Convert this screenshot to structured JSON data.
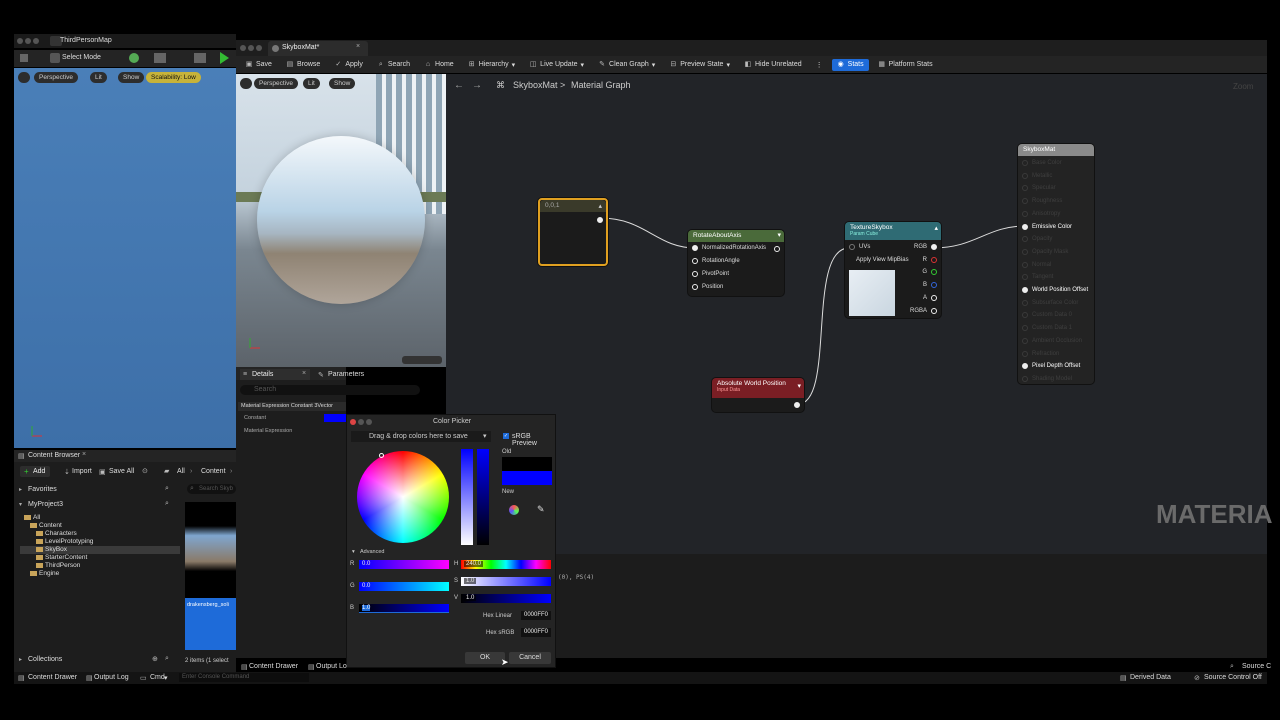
{
  "left_window": {
    "title": "ThirdPersonMap",
    "select_mode": "Select Mode",
    "viewport_pills": [
      "Perspective",
      "Lit",
      "Show"
    ],
    "scalability": "Scalability: Low"
  },
  "editor": {
    "tab_title": "SkyboxMat*",
    "toolbar": [
      {
        "label": "Save",
        "icon": "save-icon"
      },
      {
        "label": "Browse",
        "icon": "folder-icon"
      },
      {
        "label": "Apply",
        "icon": "apply-icon"
      },
      {
        "label": "Search",
        "icon": "search-icon"
      },
      {
        "label": "Home",
        "icon": "home-icon"
      },
      {
        "label": "Hierarchy",
        "icon": "hierarchy-icon"
      },
      {
        "label": "Live Update",
        "icon": "live-update-icon"
      },
      {
        "label": "Clean Graph",
        "icon": "clean-graph-icon"
      },
      {
        "label": "Preview State",
        "icon": "preview-state-icon"
      },
      {
        "label": "Hide Unrelated",
        "icon": "hide-unrelated-icon"
      },
      {
        "label": "Stats",
        "icon": "stats-icon"
      },
      {
        "label": "Platform Stats",
        "icon": "platform-stats-icon"
      }
    ],
    "preview_pills": [
      "Perspective",
      "Lit",
      "Show"
    ],
    "breadcrumb_root": "SkyboxMat",
    "breadcrumb_sep": ">",
    "breadcrumb_page": "Material Graph",
    "zoom": "Zoom",
    "watermark": "MATERIA"
  },
  "nodes": {
    "constant": {
      "title": "0,0,1"
    },
    "rotate": {
      "title": "RotateAboutAxis",
      "pins": [
        "NormalizedRotationAxis",
        "RotationAngle",
        "PivotPoint",
        "Position"
      ]
    },
    "texture": {
      "title": "TextureSkybox",
      "subtitle": "Param Cube",
      "pins": [
        "UVs",
        "Apply View MipBias"
      ],
      "outputs": [
        "RGB",
        "R",
        "G",
        "B",
        "A",
        "RGBA"
      ]
    },
    "awp": {
      "title": "Absolute World Position",
      "subtitle": "Input Data"
    },
    "result": {
      "title": "SkyboxMat",
      "pins": [
        "Base Color",
        "Metallic",
        "Specular",
        "Roughness",
        "Anisotropy",
        "Emissive Color",
        "Opacity",
        "Opacity Mask",
        "Normal",
        "Tangent",
        "World Position Offset",
        "Subsurface Color",
        "Custom Data 0",
        "Custom Data 1",
        "Ambient Occlusion",
        "Refraction",
        "Pixel Depth Offset",
        "Shading Model"
      ],
      "active": [
        "Emissive Color",
        "World Position Offset",
        "Pixel Depth Offset"
      ]
    }
  },
  "details": {
    "tab_details": "Details",
    "tab_parameters": "Parameters",
    "search_placeholder": "Search",
    "section": "Material Expression Constant 3Vector",
    "row_constant": "Constant",
    "row_material": "Material Expression"
  },
  "color_picker": {
    "title": "Color Picker",
    "drop_hint": "Drag & drop colors here to save",
    "srgb_preview": "sRGB Preview",
    "old_label": "Old",
    "new_label": "New",
    "advanced": "Advanced",
    "r_label": "R",
    "r_value": "0.0",
    "g_label": "G",
    "g_value": "0.0",
    "b_label": "B",
    "b_value": "1.0",
    "h_label": "H",
    "h_value": "240.0",
    "s_label": "S",
    "s_value": "1.0",
    "v_label": "V",
    "v_value": "1.0",
    "hex_linear_label": "Hex Linear",
    "hex_linear": "0000FF0",
    "hex_srgb_label": "Hex sRGB",
    "hex_srgb": "0000FF0",
    "ok": "OK",
    "cancel": "Cancel",
    "old_color": "#000000",
    "new_color": "#0000ff"
  },
  "graph_log": "(0), PS(4)",
  "content_browser": {
    "title": "Content Browser",
    "add": "Add",
    "import": "Import",
    "save_all": "Save All",
    "path_all": "All",
    "path_content": "Content",
    "favorites": "Favorites",
    "project": "MyProject3",
    "search_placeholder": "Search Skyb",
    "tree": [
      "All",
      "Content",
      "Characters",
      "LevelPrototyping",
      "SkyBox",
      "StarterContent",
      "ThirdPerson",
      "Engine"
    ],
    "selected": "SkyBox",
    "asset_label": "drakensberg_soli",
    "collections": "Collections",
    "items_count": "2 items (1 select"
  },
  "statusbar": {
    "content_drawer": "Content Drawer",
    "output_log": "Output Log",
    "cmd": "Cmd",
    "console_placeholder": "Enter Console Command",
    "derived_data": "Derived Data",
    "source_control": "Source Control Off",
    "source_c": "Source C",
    "content_drawer2": "Content Drawer",
    "output_lo": "Output Lo"
  }
}
